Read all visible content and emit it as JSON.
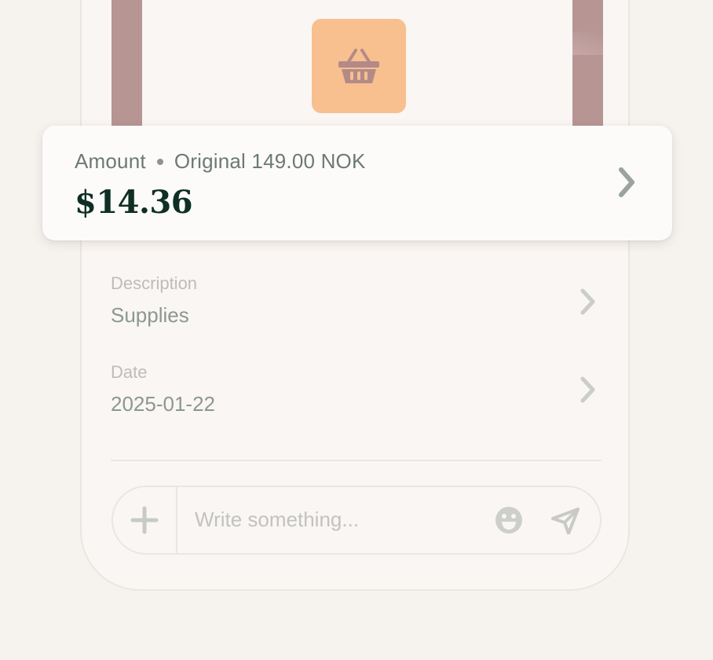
{
  "header": {
    "merchant_icon": "shopping-basket-icon",
    "colors": {
      "strip": "#b69593",
      "tile": "#f8bf8f",
      "icon": "#b48a88"
    }
  },
  "amount_card": {
    "label": "Amount",
    "original": "Original 149.00 NOK",
    "value": "$14.36"
  },
  "fields": [
    {
      "label": "Description",
      "value": "Supplies"
    },
    {
      "label": "Date",
      "value": "2025-01-22"
    }
  ],
  "composer": {
    "placeholder": "Write something...",
    "add_icon": "plus-icon",
    "emoji_icon": "emoji-icon",
    "send_icon": "send-icon"
  }
}
